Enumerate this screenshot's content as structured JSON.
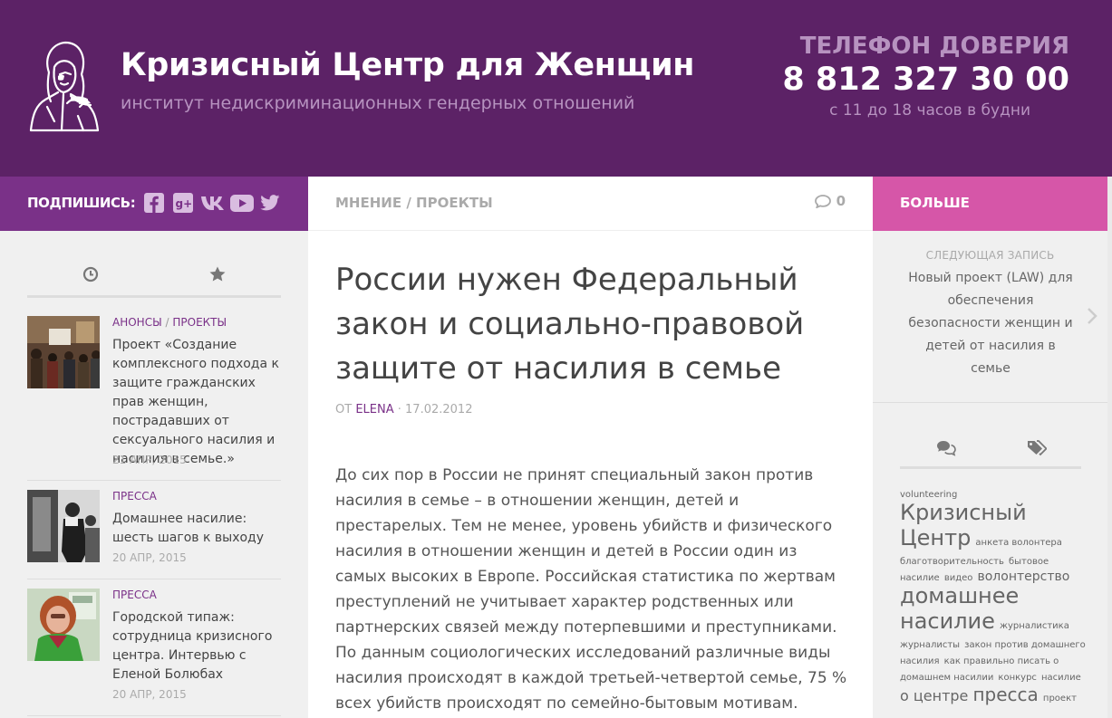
{
  "header": {
    "site_title": "Кризисный Центр для Женщин",
    "site_description": "институт недискриминационных гендерных отношений",
    "hotline_label": "ТЕЛЕФОН ДОВЕРИЯ",
    "hotline_phone": "8 812 327 30 00",
    "hotline_hours": "с 11 до 18 часов в будни"
  },
  "subscribe": {
    "label": "ПОДПИШИСЬ:",
    "icons": [
      "facebook-icon",
      "google-plus-icon",
      "vk-icon",
      "youtube-icon",
      "twitter-icon"
    ]
  },
  "breadcrumb": {
    "cat1": "МНЕНИЕ",
    "separator": "/",
    "cat2": "ПРОЕКТЫ",
    "comment_count": "0"
  },
  "more": {
    "label": "БОЛЬШЕ"
  },
  "left_sidebar": {
    "tabs": [
      "clock-icon",
      "star-icon"
    ],
    "posts": [
      {
        "category1": "АНОНСЫ",
        "category2": "ПРОЕКТЫ",
        "title": "Проект «Создание комплексного подхода к защите гражданских прав женщин, пострадавших от сексуального насилия и насилия в семье.»",
        "date": "21 АПР, 2015"
      },
      {
        "category1": "ПРЕССА",
        "title": "Домашнее насилие: шесть шагов к выходу",
        "date": "20 АПР, 2015"
      },
      {
        "category1": "ПРЕССА",
        "title": "Городской типаж: сотрудница кризисного центра. Интервью с Еленой Болюбах",
        "date": "20 АПР, 2015"
      }
    ]
  },
  "article": {
    "title": "России нужен Федеральный закон и социально-правовой защите от насилия в семье",
    "by": "ОТ",
    "author": "ELENA",
    "date": "· 17.02.2012",
    "paragraph1": "До сих пор в России не принят специальный закон против насилия в семье – в отношении женщин, детей и престарелых. Тем не менее, уровень убийств и физического насилия в отношении женщин и детей в России один из самых высоких в Европе. Российская статистика по жертвам преступлений не учитывает характер родственных или партнерских связей между потерпевшими и преступниками.",
    "paragraph2": "По данным социологических исследований различные виды насилия происходят в каждой третьей-четвертой семье, 75 % всех убийств происходят по семейно-бытовым мотивам."
  },
  "right_sidebar": {
    "next_label": "СЛЕДУЮЩАЯ ЗАПИСЬ",
    "next_title": "Новый проект (LAW) для обеспечения безопасности женщин и детей от насилия в семье",
    "tabs": [
      "comments-icon",
      "tags-icon"
    ],
    "tags": [
      "volunteering",
      "Кризисный Центр",
      "анкета волонтера",
      "благотворительность",
      "бытовое насилие",
      "видео",
      "волонтерство",
      "домашнее насилие",
      "журналистика",
      "журналисты",
      "закон против домашнего насилия",
      "как правильно писать о домашнем насилии",
      "конкурс",
      "насилие",
      "о центре",
      "пресса",
      "проект"
    ]
  },
  "colors": {
    "header_bg": "#5c2266",
    "subscribe_bg": "#7a3188",
    "more_bg": "#d656a8",
    "accent_text": "#b793c0",
    "link": "#7a3188"
  }
}
